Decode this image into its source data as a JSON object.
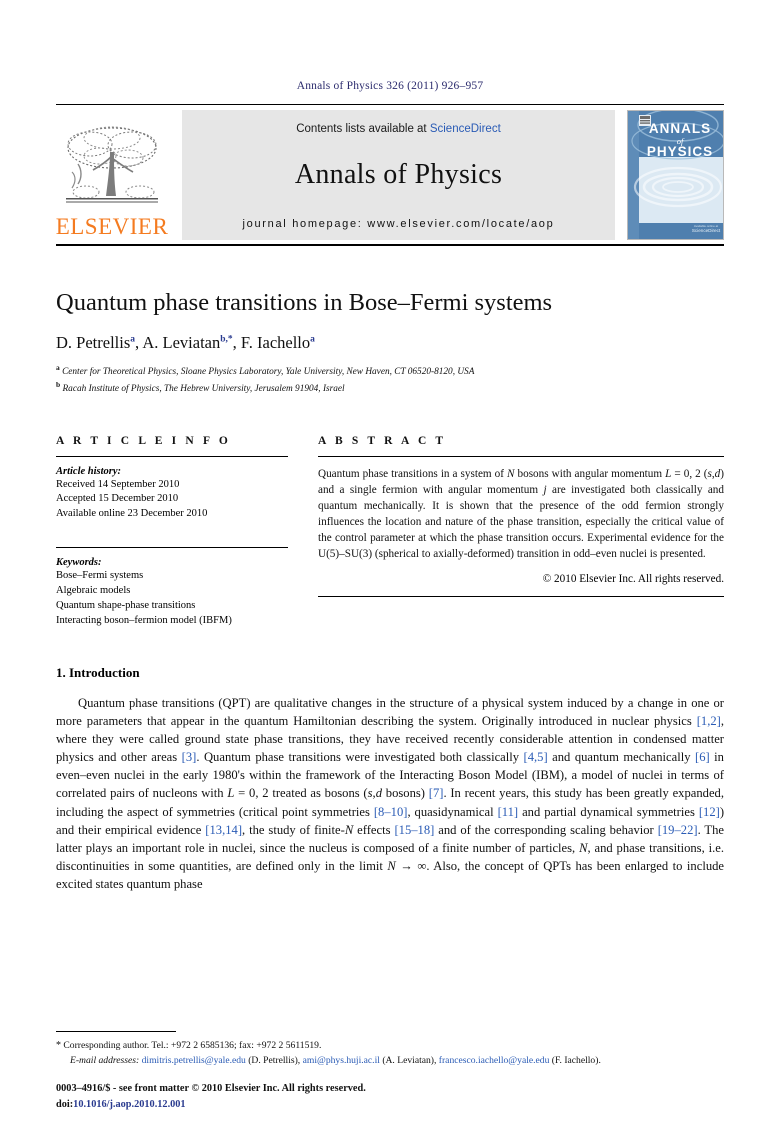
{
  "running_head": "Annals of Physics 326 (2011) 926–957",
  "journal_banner": {
    "contents_prefix": "Contents lists available at ",
    "sciencedirect": "ScienceDirect",
    "journal_name": "Annals of Physics",
    "homepage": "journal homepage: www.elsevier.com/locate/aop",
    "publisher_wordmark": "ELSEVIER",
    "cover_title_line1": "ANNALS",
    "cover_title_line2": "of",
    "cover_title_line3": "PHYSICS",
    "cover_footer": "ScienceDirect",
    "accent_link_color": "#2a5bb5",
    "elsevier_orange": "#F47B20",
    "banner_bg": "#e6e6e6",
    "cover_blue": "#5b89b8"
  },
  "article": {
    "title": "Quantum phase transitions in Bose–Fermi systems",
    "authors": [
      {
        "name": "D. Petrellis",
        "marker": "a"
      },
      {
        "name": "A. Leviatan",
        "marker": "b,*"
      },
      {
        "name": "F. Iachello",
        "marker": "a"
      }
    ],
    "authors_plain": "D. Petrellis a, A. Leviatan b,*, F. Iachello a",
    "affiliations": [
      {
        "marker": "a",
        "text": "Center for Theoretical Physics, Sloane Physics Laboratory, Yale University, New Haven, CT 06520-8120, USA"
      },
      {
        "marker": "b",
        "text": "Racah Institute of Physics, The Hebrew University, Jerusalem 91904, Israel"
      }
    ]
  },
  "article_info": {
    "heading": "A R T I C L E    I N F O",
    "history_label": "Article history:",
    "history": [
      "Received 14 September 2010",
      "Accepted 15 December 2010",
      "Available online 23 December 2010"
    ],
    "keywords_label": "Keywords:",
    "keywords": [
      "Bose–Fermi systems",
      "Algebraic models",
      "Quantum shape-phase transitions",
      "Interacting boson–fermion model (IBFM)"
    ]
  },
  "abstract": {
    "heading": "A B S T R A C T",
    "text_html": "Quantum phase transitions in a system of <i>N</i> bosons with angular momentum <i>L</i> = 0, 2 (<i>s</i>,<i>d</i>) and a single fermion with angular momentum <i>j</i> are investigated both classically and quantum mechanically. It is shown that the presence of the odd fermion strongly influences the location and nature of the phase transition, especially the critical value of the control parameter at which the phase transition occurs. Experimental evidence for the U(5)–SU(3) (spherical to axially-deformed) transition in odd–even nuclei is presented.",
    "copyright": "© 2010 Elsevier Inc. All rights reserved."
  },
  "body": {
    "section_heading": "1. Introduction",
    "paragraph_html": "Quantum phase transitions (QPT) are qualitative changes in the structure of a physical system induced by a change in one or more parameters that appear in the quantum Hamiltonian describing the system. Originally introduced in nuclear physics <span class=\"ref\">[1,2]</span>, where they were called ground state phase transitions, they have received recently considerable attention in condensed matter physics and other areas <span class=\"ref\">[3]</span>. Quantum phase transitions were investigated both classically <span class=\"ref\">[4,5]</span> and quantum mechanically <span class=\"ref\">[6]</span> in even–even nuclei in the early 1980's within the framework of the Interacting Boson Model (IBM), a model of nuclei in terms of correlated pairs of nucleons with <i>L</i> = 0, 2 treated as bosons (<i>s</i>,<i>d</i> bosons) <span class=\"ref\">[7]</span>. In recent years, this study has been greatly expanded, including the aspect of symmetries (critical point symmetries <span class=\"ref\">[8–10]</span>, quasidynamical <span class=\"ref\">[11]</span> and partial dynamical symmetries <span class=\"ref\">[12]</span>) and their empirical evidence <span class=\"ref\">[13,14]</span>, the study of finite-<i>N</i> effects <span class=\"ref\">[15–18]</span> and of the corresponding scaling behavior <span class=\"ref\">[19–22]</span>. The latter plays an important role in nuclei, since the nucleus is composed of a finite number of particles, <i>N</i>, and phase transitions, i.e. discontinuities in some quantities, are defined only in the limit <i>N</i> → ∞. Also, the concept of QPTs has been enlarged to include excited states quantum phase"
  },
  "footnotes": {
    "corresponding_html": "<span class=\"star\">*</span> Corresponding author. Tel.: +972 2 6585136; fax: +972 2 5611519.",
    "email_label": "E-mail addresses:",
    "emails": [
      {
        "address": "dimitris.petrellis@yale.edu",
        "person": "(D. Petrellis)"
      },
      {
        "address": "ami@phys.huji.ac.il",
        "person": "(A. Leviatan)"
      },
      {
        "address": "francesco.iachello@yale.edu",
        "person": "(F. Iachello)"
      }
    ]
  },
  "issn_footer": {
    "line1": "0003–4916/$ - see front matter © 2010 Elsevier Inc. All rights reserved.",
    "doi_label": "doi:",
    "doi": "10.1016/j.aop.2010.12.001"
  }
}
